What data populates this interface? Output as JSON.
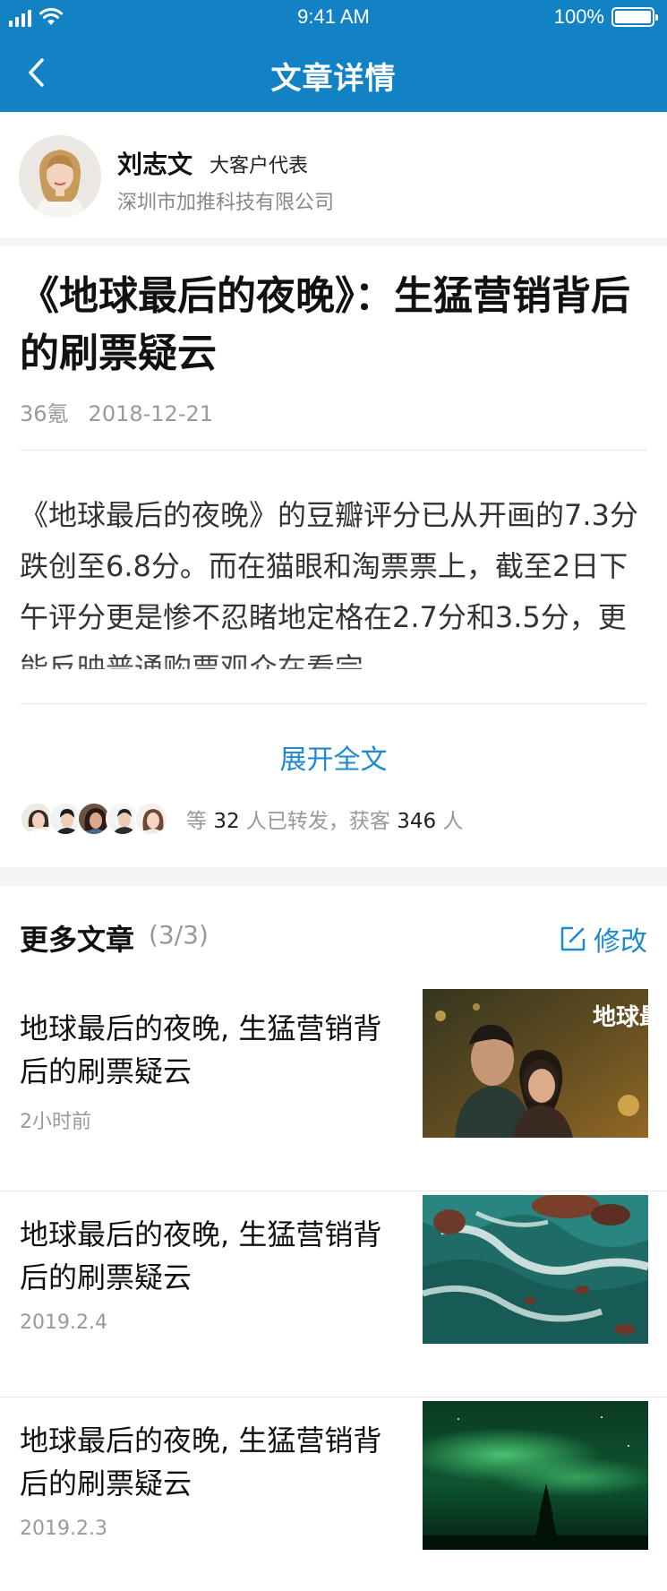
{
  "status_bar": {
    "time": "9:41 AM",
    "battery": "100%"
  },
  "nav": {
    "title": "文章详情"
  },
  "author": {
    "name": "刘志文",
    "role": "大客户代表",
    "company": "深圳市加推科技有限公司"
  },
  "article": {
    "title": "《地球最后的夜晚》：生猛营销背后的刷票疑云",
    "source": "36氪",
    "date": "2018-12-21",
    "body": "《地球最后的夜晚》的豆瓣评分已从开画的7.3分跌创至6.8分。而在猫眼和淘票票上，截至2日下午评分更是惨不忍睹地定格在2.7分和3.5分，更能反映普通购票观众在看完",
    "expand_label": "展开全文",
    "share": {
      "prefix": "等",
      "forwards": "32",
      "middle": "人已转发，获客",
      "customers": "346",
      "suffix": "人"
    }
  },
  "more": {
    "title": "更多文章",
    "count": "(3/3)",
    "edit_label": "修改",
    "items": [
      {
        "title": "地球最后的夜晚, 生猛营销背后的刷票疑云",
        "time": "2小时前",
        "thumb_text": "地球最后的夜晚"
      },
      {
        "title": "地球最后的夜晚, 生猛营销背后的刷票疑云",
        "time": "2019.2.4"
      },
      {
        "title": "地球最后的夜晚, 生猛营销背后的刷票疑云",
        "time": "2019.2.3"
      }
    ]
  },
  "icons": {
    "back": "chevron-left-icon",
    "edit": "edit-icon",
    "signal": "signal-icon",
    "wifi": "wifi-icon",
    "battery": "battery-icon"
  },
  "colors": {
    "brand_blue": "#1282c5",
    "link_blue": "#1d8ad0"
  }
}
